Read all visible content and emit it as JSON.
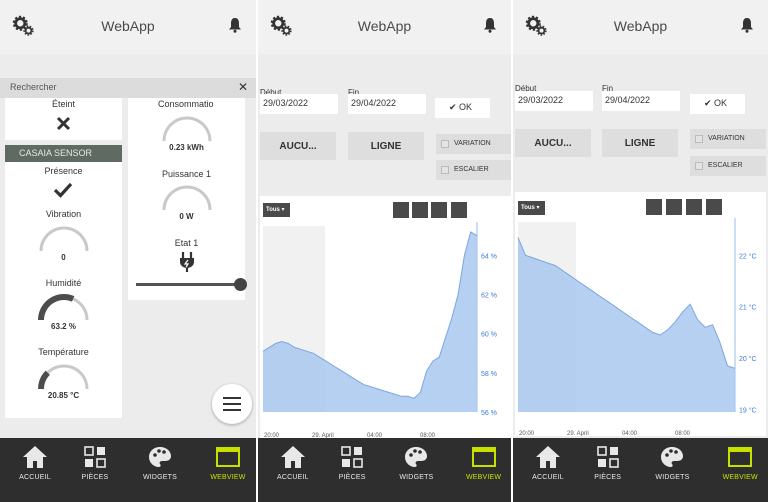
{
  "app": {
    "title": "WebApp"
  },
  "nav": {
    "items": [
      {
        "label": "ACCUEIL",
        "icon": "home-icon"
      },
      {
        "label": "PIÈCES",
        "icon": "grid-icon"
      },
      {
        "label": "WIDGETS",
        "icon": "palette-icon"
      },
      {
        "label": "WEBVIEW",
        "icon": "webview-icon",
        "active": true
      }
    ]
  },
  "screen1": {
    "search_placeholder": "Rechercher",
    "left_cards": {
      "eteint_label": "Éteint",
      "sensor_header": "CASAIA SENSOR",
      "presence_label": "Présence",
      "vibration_label": "Vibration",
      "vibration_value": "0",
      "vibration_level": 0,
      "humidity_label": "Humidité",
      "humidity_value": "63.2 %",
      "humidity_level": 0.63,
      "temperature_label": "Température",
      "temperature_value": "20.85 °C",
      "temperature_level": 0.25
    },
    "right_card": {
      "consumption_label": "Consommatio",
      "consumption_value": "0.23 kWh",
      "consumption_level": 0,
      "power_label": "Puissance 1",
      "power_value": "0 W",
      "power_level": 0,
      "state_label": "Etat 1",
      "slider_level": 1.0
    }
  },
  "screen2": {
    "start_label": "Début",
    "start_value": "29/03/2022",
    "end_label": "Fin",
    "end_value": "29/04/2022",
    "ok_label": "OK",
    "btn_aucun": "AUCU...",
    "btn_ligne": "LIGNE",
    "variation_label": "VARIATION",
    "escalier_label": "ESCALIER",
    "tous_label": "Tous",
    "chart_data": {
      "type": "area",
      "y_ticks": [
        "64 %",
        "62 %",
        "60 %",
        "58 %",
        "56 %"
      ],
      "x_ticks": [
        "20:00",
        "29. April",
        "04:00",
        "08:00"
      ],
      "ylim": [
        56,
        65.5
      ],
      "values": [
        59.1,
        59.3,
        59.5,
        59.6,
        59.5,
        59.3,
        59.2,
        59.1,
        59.0,
        58.8,
        58.6,
        58.4,
        58.2,
        58.0,
        57.8,
        57.6,
        57.4,
        57.3,
        57.2,
        57.1,
        57.0,
        56.9,
        56.8,
        56.8,
        56.7,
        57.0,
        58.1,
        58.6,
        58.8,
        59.8,
        60.8,
        62.0,
        64.0,
        65.2,
        65.0
      ]
    }
  },
  "screen3": {
    "start_label": "Début",
    "start_value": "29/03/2022",
    "end_label": "Fin",
    "end_value": "29/04/2022",
    "ok_label": "OK",
    "btn_aucun": "AUCU...",
    "btn_ligne": "LIGNE",
    "variation_label": "VARIATION",
    "escalier_label": "ESCALIER",
    "tous_label": "Tous",
    "chart_data": {
      "type": "area",
      "y_ticks": [
        "22 °C",
        "21 °C",
        "20 °C",
        "19 °C"
      ],
      "x_ticks": [
        "20:00",
        "29. April",
        "04:00",
        "08:00"
      ],
      "ylim": [
        18.95,
        22.65
      ],
      "values": [
        22.35,
        22.0,
        21.95,
        21.9,
        21.85,
        21.8,
        21.7,
        21.6,
        21.5,
        21.4,
        21.3,
        21.2,
        21.1,
        21.0,
        20.9,
        20.8,
        20.7,
        20.6,
        20.5,
        20.45,
        20.55,
        20.7,
        20.9,
        21.05,
        20.75,
        20.6,
        20.65,
        20.3,
        19.85,
        19.8
      ]
    }
  }
}
